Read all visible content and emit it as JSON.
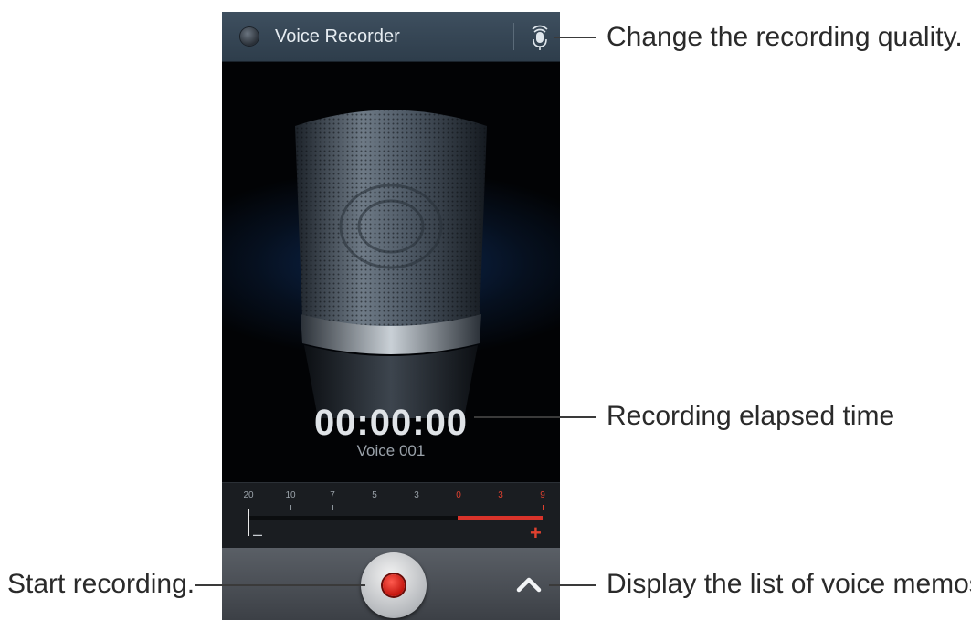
{
  "app": {
    "title": "Voice Recorder"
  },
  "recorder": {
    "elapsed": "00:00:00",
    "name": "Voice 001"
  },
  "meter": {
    "scale": [
      "20",
      "10",
      "7",
      "5",
      "3",
      "0",
      "3",
      "9"
    ],
    "minus": "–",
    "plus": "+"
  },
  "callouts": {
    "quality": "Change the recording quality.",
    "elapsed": "Recording elapsed time",
    "start": "Start recording.",
    "list": "Display the list of voice memos."
  },
  "icons": {
    "app": "voice-recorder-icon",
    "quality": "microphone-settings-icon",
    "record": "record-icon",
    "list": "chevron-up-icon"
  },
  "colors": {
    "accent_red": "#e0412f",
    "action_bar": "#35475a"
  }
}
